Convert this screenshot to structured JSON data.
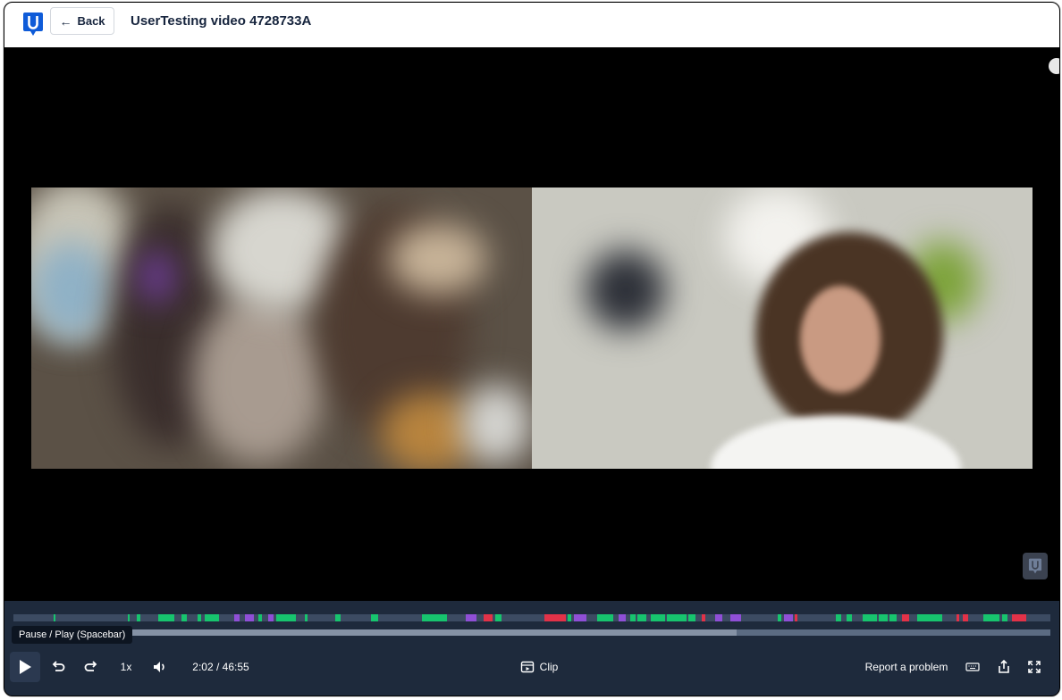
{
  "header": {
    "back_label": "Back",
    "title": "UserTesting video 4728733A"
  },
  "player": {
    "tooltip": "Pause / Play (Spacebar)",
    "speed": "1x",
    "time": "2:02 / 46:55",
    "clip_label": "Clip",
    "report_label": "Report a problem",
    "progress": 0.697
  },
  "colors": {
    "green": "#17c46e",
    "purple": "#8f4fd6",
    "red": "#e23248",
    "brand": "#0e5bd8"
  },
  "icons": [
    "logo-icon",
    "back-arrow-icon",
    "play-icon",
    "rewind-icon",
    "forward-icon",
    "volume-icon",
    "clip-icon",
    "keyboard-icon",
    "share-icon",
    "fullscreen-icon"
  ]
}
